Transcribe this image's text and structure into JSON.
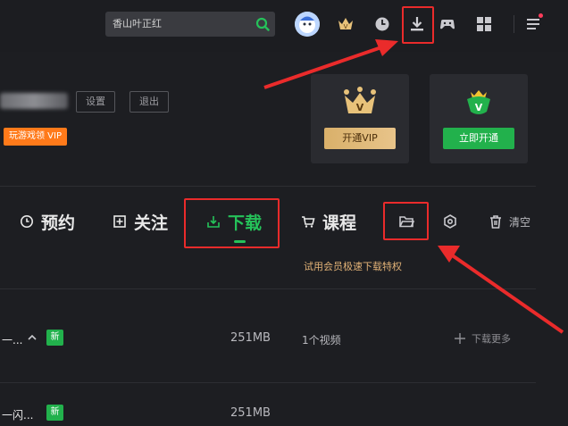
{
  "header": {
    "search_value": "香山叶正红",
    "icons": [
      "search-icon",
      "avatar",
      "crown-icon",
      "history-icon",
      "download-icon",
      "gamepad-icon",
      "grid-icon",
      "menu-icon"
    ]
  },
  "user": {
    "settings_label": "设置",
    "logout_label": "退出",
    "vip_tag": "玩游戏领 VIP"
  },
  "cards": [
    {
      "button": "开通VIP",
      "accent": "#e8c27a"
    },
    {
      "button": "立即开通",
      "accent": "#22b14c"
    }
  ],
  "tabs": [
    {
      "label": "预约",
      "icon": "clock-icon"
    },
    {
      "label": "关注",
      "icon": "follow-icon"
    },
    {
      "label": "下载",
      "icon": "download-tab-icon",
      "active": true
    },
    {
      "label": "课程",
      "icon": "cart-icon"
    }
  ],
  "toolbar": {
    "clear_label": "清空",
    "icons": [
      "folder-icon",
      "settings-hex-icon",
      "trash-icon"
    ]
  },
  "promo_text": "试用会员极速下载特权",
  "downloads": [
    {
      "name": "一...",
      "badge": "新",
      "size": "251MB",
      "count": "1个视频",
      "more": "下载更多"
    },
    {
      "name": "一闪...",
      "badge": "新",
      "size": "251MB"
    }
  ],
  "colors": {
    "accent_green": "#25c25a",
    "annotation_red": "#ea2b2b",
    "vip_orange": "#ff7a1a",
    "promo_gold": "#e2b277"
  }
}
